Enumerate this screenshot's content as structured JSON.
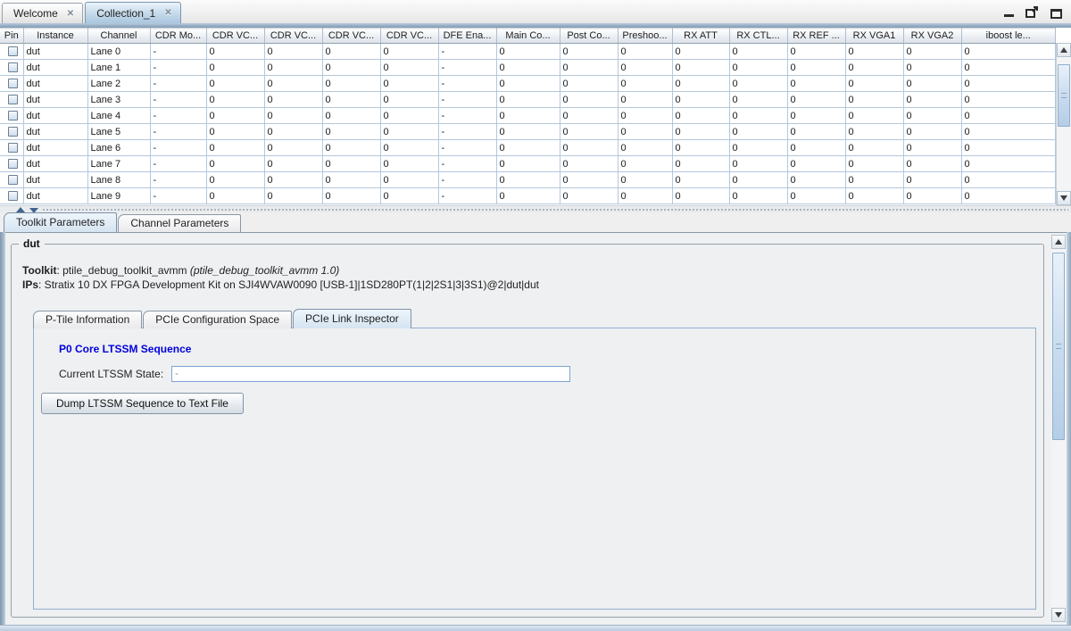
{
  "window": {
    "tabs": [
      {
        "label": "Welcome"
      },
      {
        "label": "Collection_1"
      }
    ],
    "active_tab": "Collection_1",
    "controls": [
      {
        "name": "minimize"
      },
      {
        "name": "float"
      },
      {
        "name": "maximize"
      }
    ]
  },
  "icons": {
    "tab_close": "✕"
  },
  "table": {
    "columns": [
      "Pin",
      "Instance",
      "Channel",
      "CDR Mo...",
      "CDR VC...",
      "CDR VC...",
      "CDR VC...",
      "CDR VC...",
      "DFE Ena...",
      "Main Co...",
      "Post Co...",
      "Preshoo...",
      "RX ATT",
      "RX CTL...",
      "RX REF ...",
      "RX VGA1",
      "RX VGA2",
      "iboost le..."
    ],
    "rows": [
      {
        "pin_checked": false,
        "instance": "dut",
        "channel": "Lane 0",
        "values": [
          "-",
          "0",
          "0",
          "0",
          "0",
          "-",
          "0",
          "0",
          "0",
          "0",
          "0",
          "0",
          "0",
          "0",
          "0"
        ]
      },
      {
        "pin_checked": false,
        "instance": "dut",
        "channel": "Lane 1",
        "values": [
          "-",
          "0",
          "0",
          "0",
          "0",
          "-",
          "0",
          "0",
          "0",
          "0",
          "0",
          "0",
          "0",
          "0",
          "0"
        ]
      },
      {
        "pin_checked": false,
        "instance": "dut",
        "channel": "Lane 2",
        "values": [
          "-",
          "0",
          "0",
          "0",
          "0",
          "-",
          "0",
          "0",
          "0",
          "0",
          "0",
          "0",
          "0",
          "0",
          "0"
        ]
      },
      {
        "pin_checked": false,
        "instance": "dut",
        "channel": "Lane 3",
        "values": [
          "-",
          "0",
          "0",
          "0",
          "0",
          "-",
          "0",
          "0",
          "0",
          "0",
          "0",
          "0",
          "0",
          "0",
          "0"
        ]
      },
      {
        "pin_checked": false,
        "instance": "dut",
        "channel": "Lane 4",
        "values": [
          "-",
          "0",
          "0",
          "0",
          "0",
          "-",
          "0",
          "0",
          "0",
          "0",
          "0",
          "0",
          "0",
          "0",
          "0"
        ]
      },
      {
        "pin_checked": false,
        "instance": "dut",
        "channel": "Lane 5",
        "values": [
          "-",
          "0",
          "0",
          "0",
          "0",
          "-",
          "0",
          "0",
          "0",
          "0",
          "0",
          "0",
          "0",
          "0",
          "0"
        ]
      },
      {
        "pin_checked": false,
        "instance": "dut",
        "channel": "Lane 6",
        "values": [
          "-",
          "0",
          "0",
          "0",
          "0",
          "-",
          "0",
          "0",
          "0",
          "0",
          "0",
          "0",
          "0",
          "0",
          "0"
        ]
      },
      {
        "pin_checked": false,
        "instance": "dut",
        "channel": "Lane 7",
        "values": [
          "-",
          "0",
          "0",
          "0",
          "0",
          "-",
          "0",
          "0",
          "0",
          "0",
          "0",
          "0",
          "0",
          "0",
          "0"
        ]
      },
      {
        "pin_checked": false,
        "instance": "dut",
        "channel": "Lane 8",
        "values": [
          "-",
          "0",
          "0",
          "0",
          "0",
          "-",
          "0",
          "0",
          "0",
          "0",
          "0",
          "0",
          "0",
          "0",
          "0"
        ]
      },
      {
        "pin_checked": false,
        "instance": "dut",
        "channel": "Lane 9",
        "values": [
          "-",
          "0",
          "0",
          "0",
          "0",
          "-",
          "0",
          "0",
          "0",
          "0",
          "0",
          "0",
          "0",
          "0",
          "0"
        ]
      }
    ]
  },
  "bottom_tabs": {
    "items": [
      "Toolkit Parameters",
      "Channel Parameters"
    ],
    "active": "Toolkit Parameters"
  },
  "panel": {
    "group_title": "dut",
    "toolkit": {
      "label": "Toolkit",
      "value": ": ptile_debug_toolkit_avmm ",
      "version": "(ptile_debug_toolkit_avmm 1.0)"
    },
    "ips": {
      "label": "IPs",
      "value": ": Stratix 10 DX FPGA Development Kit on SJI4WVAW0090 [USB-1]|1SD280PT(1|2|2S1|3|3S1)@2|dut|dut"
    },
    "inner_tabs": {
      "items": [
        "P-Tile Information",
        "PCIe Configuration Space",
        "PCIe Link Inspector"
      ],
      "active": "PCIe Link Inspector"
    },
    "ltssm": {
      "heading": "P0 Core LTSSM Sequence",
      "state_label": "Current LTSSM State:",
      "state_value": "-",
      "dump_button": "Dump LTSSM Sequence to Text File"
    }
  },
  "colors": {
    "active_view_tab": "#a9c6de",
    "accent_strip": "#7e9ab3",
    "table_grid": "#b3c8dd",
    "heading_blue": "#0000dd",
    "selected_tab_fill": "#d5e4f1",
    "scroll_thumb": "#bcd2e8",
    "frame_border": "#7e95ad",
    "status_bar": "#c9d8e7"
  }
}
